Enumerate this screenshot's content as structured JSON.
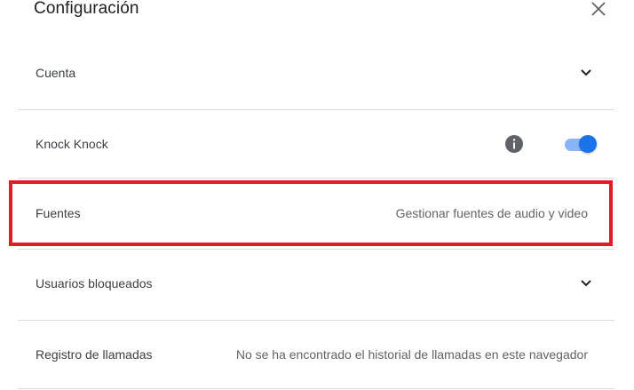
{
  "dialog": {
    "title": "Configuración",
    "close_icon": "close-icon"
  },
  "settings": {
    "cuenta": {
      "label": "Cuenta",
      "icon": "chevron-down-icon"
    },
    "knock_knock": {
      "label": "Knock Knock",
      "info_icon": "info-icon",
      "enabled": true
    },
    "fuentes": {
      "label": "Fuentes",
      "action": "Gestionar fuentes de audio y video"
    },
    "usuarios_bloqueados": {
      "label": "Usuarios bloqueados",
      "icon": "chevron-down-icon"
    },
    "registro_llamadas": {
      "label": "Registro de llamadas",
      "status": "No se ha encontrado el historial de llamadas en este navegador"
    }
  },
  "colors": {
    "accent": "#1a73e8",
    "toggle_track": "#8ab4f8",
    "highlight": "#e21b2b",
    "divider": "#dadce0"
  }
}
